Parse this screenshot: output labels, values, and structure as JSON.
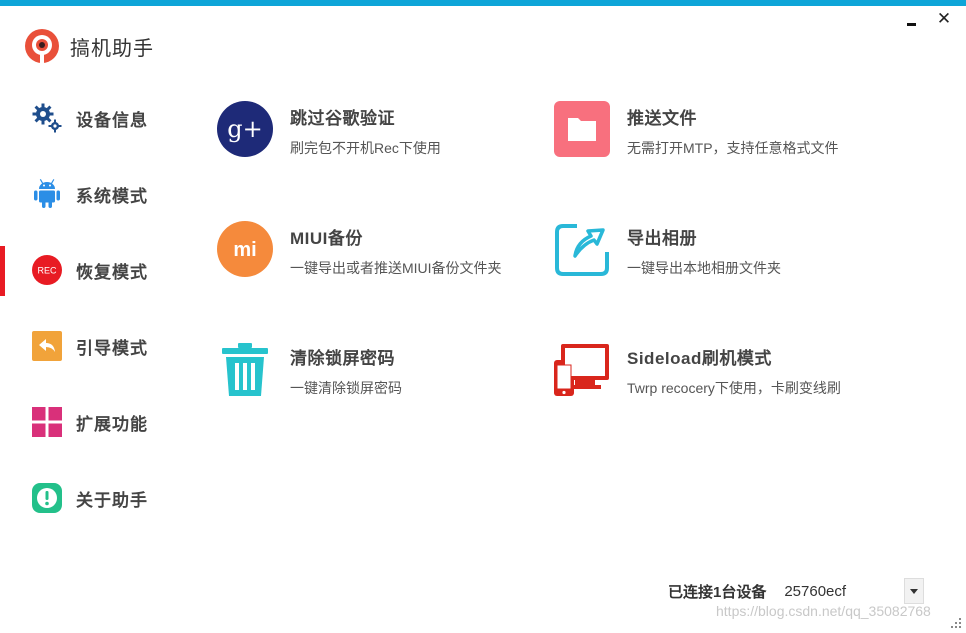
{
  "app": {
    "name": "搞机助手",
    "accent_color": "#0ea5d8",
    "active_indicator_color": "#e81b23"
  },
  "window_controls": {
    "minimize_icon": "minimize-icon",
    "close_symbol": "✕"
  },
  "sidebar": {
    "items": [
      {
        "label": "设备信息",
        "icon": "gears-icon",
        "active": false
      },
      {
        "label": "系统模式",
        "icon": "android-icon",
        "active": false
      },
      {
        "label": "恢复模式",
        "icon": "rec-icon",
        "icon_text": "REC",
        "active": true
      },
      {
        "label": "引导模式",
        "icon": "return-arrow-icon",
        "active": false
      },
      {
        "label": "扩展功能",
        "icon": "grid-icon",
        "active": false
      },
      {
        "label": "关于助手",
        "icon": "info-alert-icon",
        "active": false
      }
    ]
  },
  "features": [
    {
      "title": "跳过谷歌验证",
      "desc": "刷完包不开机Rec下使用",
      "icon": "google-plus-icon",
      "icon_text": "g+",
      "color": "#1e2a78"
    },
    {
      "title": "推送文件",
      "desc": "无需打开MTP，支持任意格式文件",
      "icon": "folder-icon",
      "color": "#f8707e"
    },
    {
      "title": "MIUI备份",
      "desc": "一键导出或者推送MIUI备份文件夹",
      "icon": "mi-icon",
      "icon_text": "mi",
      "color": "#f58a3c"
    },
    {
      "title": "导出相册",
      "desc": "一键导出本地相册文件夹",
      "icon": "export-album-icon",
      "color": "#29b8d8"
    },
    {
      "title": "清除锁屏密码",
      "desc": "一键清除锁屏密码",
      "icon": "trash-icon",
      "color": "#27c3cd"
    },
    {
      "title": "Sideload刷机模式",
      "desc": "Twrp recocery下使用，卡刷变线刷",
      "icon": "phone-monitor-icon",
      "color": "#d9261c"
    }
  ],
  "status": {
    "label": "已连接1台设备",
    "device": "25760ecf"
  },
  "watermark": "https://blog.csdn.net/qq_35082768"
}
